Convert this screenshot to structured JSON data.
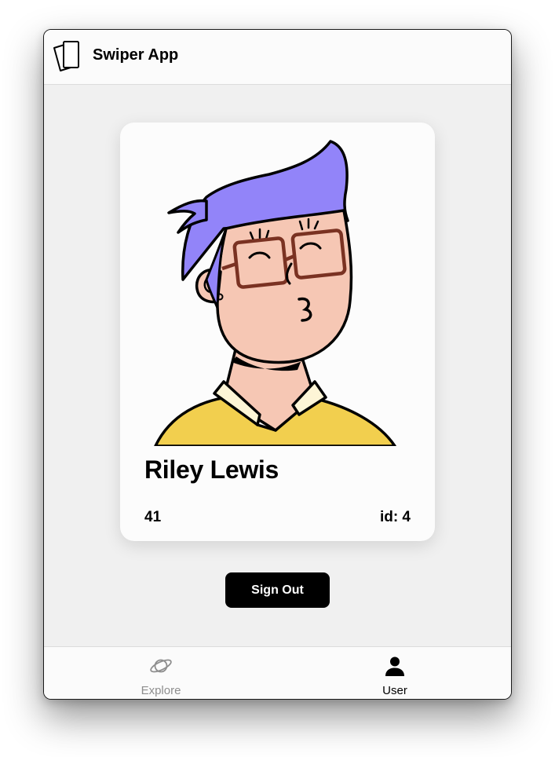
{
  "app": {
    "title": "Swiper App",
    "logo_icon": "cards-icon"
  },
  "profile": {
    "name": "Riley Lewis",
    "age": "41",
    "id_text": "id: 4",
    "avatar": "cartoon-avatar-kissing-face-with-glasses"
  },
  "actions": {
    "sign_out_label": "Sign Out"
  },
  "tabs": [
    {
      "label": "Explore",
      "icon": "planet-icon",
      "active": false
    },
    {
      "label": "User",
      "icon": "user-icon",
      "active": true
    }
  ],
  "colors": {
    "window_bg": "#f0f0f0",
    "card_bg": "#fcfcfc",
    "button_bg": "#000000",
    "hair": "#9284f9",
    "skin": "#f6c7b4",
    "shirt": "#f2cf4e",
    "glasses": "#7a3222",
    "tab_inactive": "#8e8e8e"
  }
}
